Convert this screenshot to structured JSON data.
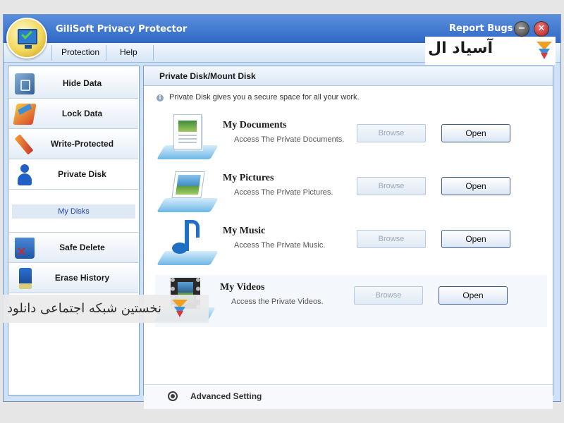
{
  "app": {
    "title": "GiliSoft Privacy Protector",
    "report_bugs": "Report Bugs",
    "minimize_symbol": "−",
    "close_symbol": "✕"
  },
  "menu": {
    "items": [
      "Protection",
      "Help"
    ]
  },
  "sidebar": {
    "items": [
      {
        "label": "Hide Data",
        "icon": "safe-icon"
      },
      {
        "label": "Lock Data",
        "icon": "lock-folder-icon"
      },
      {
        "label": "Write-Protected",
        "icon": "pencil-icon"
      },
      {
        "label": "Private Disk",
        "icon": "person-icon"
      },
      {
        "label": "Safe Delete",
        "icon": "trash-icon"
      },
      {
        "label": "Erase History",
        "icon": "eraser-icon"
      }
    ],
    "sub_items": [
      "My Disks"
    ]
  },
  "main": {
    "header": "Private Disk/Mount Disk",
    "info": "Private Disk gives you a secure space for all your work.",
    "cards": [
      {
        "title": "My Documents",
        "description": "Access The Private Documents.",
        "browse": "Browse",
        "open": "Open"
      },
      {
        "title": "My Pictures",
        "description": "Access The Private Pictures.",
        "browse": "Browse",
        "open": "Open"
      },
      {
        "title": "My Music",
        "description": "Access The Private Music.",
        "browse": "Browse",
        "open": "Open"
      },
      {
        "title": "My Videos",
        "description": "Access the Private Videos.",
        "browse": "Browse",
        "open": "Open"
      }
    ],
    "advanced": "Advanced Setting"
  },
  "watermarks": {
    "top": "آسیاد ال",
    "middle": "نخستین شبکه اجتماعی دانلود"
  },
  "colors": {
    "titlebar": "#2f68c6",
    "accent_link": "#1c3fa8"
  }
}
